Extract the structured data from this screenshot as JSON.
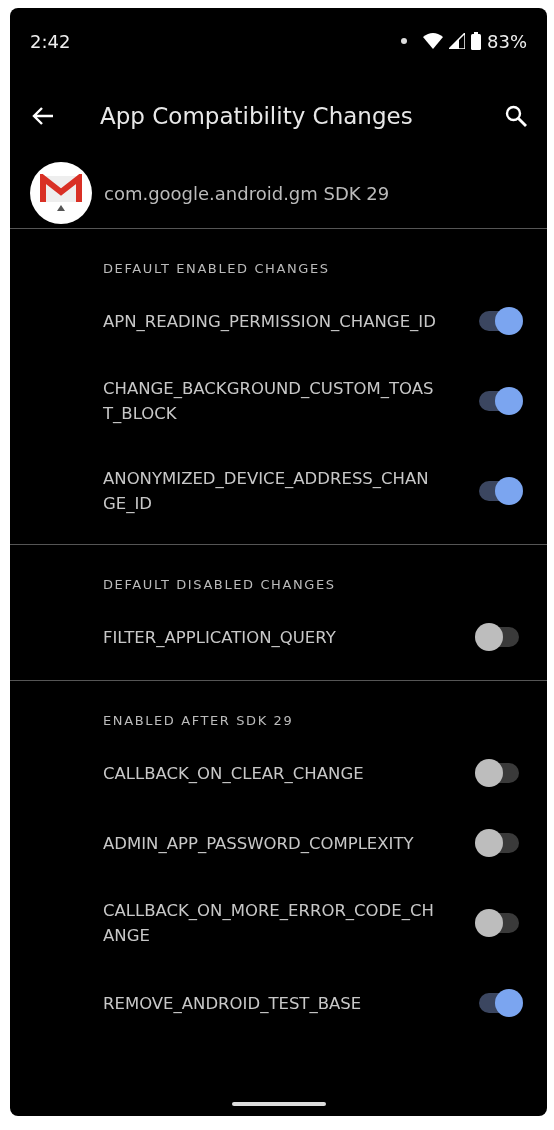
{
  "status_bar": {
    "time": "2:42",
    "battery": "83%"
  },
  "toolbar": {
    "title": "App Compatibility Changes"
  },
  "app": {
    "label": "com.google.android.gm SDK 29"
  },
  "sections": [
    {
      "title": "DEFAULT ENABLED CHANGES",
      "items": [
        {
          "label": "APN_READING_PERMISSION_CHANGE_ID",
          "on": true
        },
        {
          "label": "CHANGE_BACKGROUND_CUSTOM_TOAST_BLOCK",
          "on": true
        },
        {
          "label": "ANONYMIZED_DEVICE_ADDRESS_CHANGE_ID",
          "on": true
        }
      ]
    },
    {
      "title": "DEFAULT DISABLED CHANGES",
      "items": [
        {
          "label": "FILTER_APPLICATION_QUERY",
          "on": false
        }
      ]
    },
    {
      "title": "ENABLED AFTER SDK 29",
      "items": [
        {
          "label": "CALLBACK_ON_CLEAR_CHANGE",
          "on": false
        },
        {
          "label": "ADMIN_APP_PASSWORD_COMPLEXITY",
          "on": false
        },
        {
          "label": "CALLBACK_ON_MORE_ERROR_CODE_CHANGE",
          "on": false
        },
        {
          "label": "REMOVE_ANDROID_TEST_BASE",
          "on": true
        }
      ]
    }
  ]
}
